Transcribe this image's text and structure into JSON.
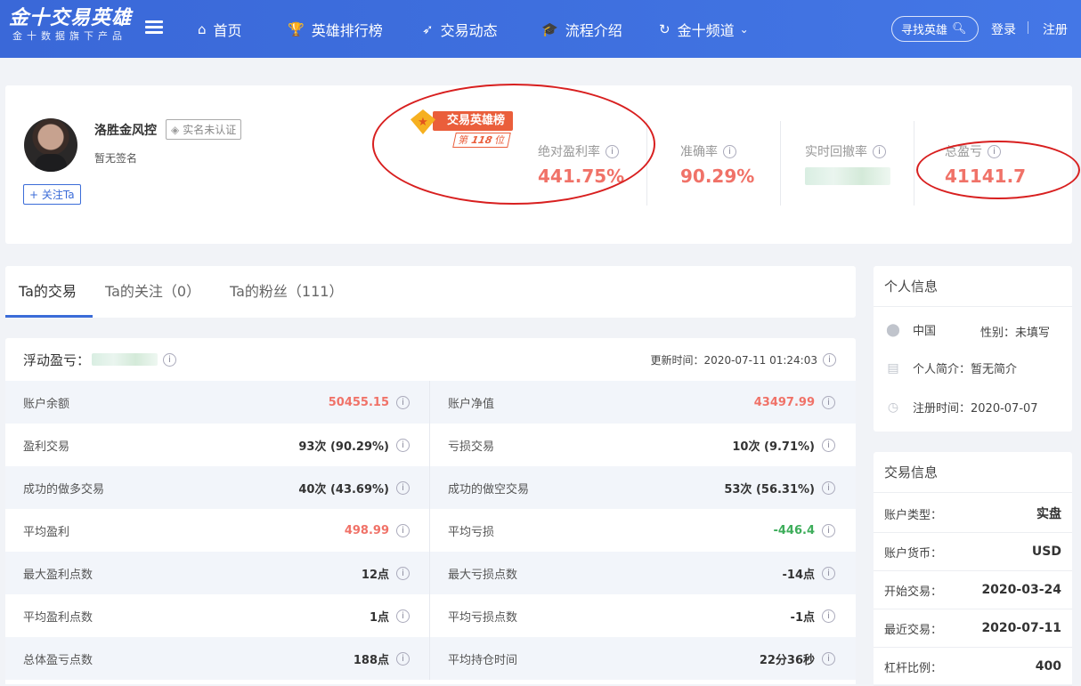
{
  "nav": {
    "logo_title": "金十交易英雄",
    "logo_subtitle": "金十数据旗下产品",
    "items": [
      {
        "label": "首页",
        "icon": "home-icon",
        "glyph": "⌂"
      },
      {
        "label": "英雄排行榜",
        "icon": "trophy-icon",
        "glyph": "🏆"
      },
      {
        "label": "交易动态",
        "icon": "rocket-icon",
        "glyph": "➶"
      },
      {
        "label": "流程介绍",
        "icon": "graduation-cap-icon",
        "glyph": "🎓"
      },
      {
        "label": "金十频道",
        "icon": "refresh-icon",
        "glyph": "↻"
      }
    ],
    "search_label": "寻找英雄",
    "login": "登录",
    "register": "注册"
  },
  "profile": {
    "name": "洛胜金风控",
    "verify_label": "实名未认证",
    "signature": "暂无签名",
    "follow_label": "+ 关注Ta",
    "hero_badge": {
      "title": "交易英雄榜",
      "rank_prefix": "第",
      "rank": "118",
      "rank_suffix": "位"
    },
    "stats": [
      {
        "label": "绝对盈利率",
        "value": "441.75%"
      },
      {
        "label": "准确率",
        "value": "90.29%"
      },
      {
        "label": "实时回撤率",
        "value": ""
      },
      {
        "label": "总盈亏",
        "value": "41141.7"
      }
    ]
  },
  "tabs": [
    {
      "label": "Ta的交易"
    },
    {
      "label": "Ta的关注（0）"
    },
    {
      "label": "Ta的粉丝（111）"
    }
  ],
  "trade": {
    "float_label": "浮动盈亏：",
    "update_time": "更新时间：2020-07-11 01:24:03",
    "rows": [
      [
        {
          "label": "账户余额",
          "value": "50455.15",
          "color": "red"
        },
        {
          "label": "账户净值",
          "value": "43497.99",
          "color": "red"
        }
      ],
      [
        {
          "label": "盈利交易",
          "value": "93次 (90.29%)",
          "color": ""
        },
        {
          "label": "亏损交易",
          "value": "10次 (9.71%)",
          "color": ""
        }
      ],
      [
        {
          "label": "成功的做多交易",
          "value": "40次 (43.69%)",
          "color": ""
        },
        {
          "label": "成功的做空交易",
          "value": "53次 (56.31%)",
          "color": ""
        }
      ],
      [
        {
          "label": "平均盈利",
          "value": "498.99",
          "color": "red"
        },
        {
          "label": "平均亏损",
          "value": "-446.4",
          "color": "green"
        }
      ],
      [
        {
          "label": "最大盈利点数",
          "value": "12点",
          "color": ""
        },
        {
          "label": "最大亏损点数",
          "value": "-14点",
          "color": ""
        }
      ],
      [
        {
          "label": "平均盈利点数",
          "value": "1点",
          "color": ""
        },
        {
          "label": "平均亏损点数",
          "value": "-1点",
          "color": ""
        }
      ],
      [
        {
          "label": "总体盈亏点数",
          "value": "188点",
          "color": ""
        },
        {
          "label": "平均持仓时间",
          "value": "22分36秒",
          "color": ""
        }
      ]
    ]
  },
  "personal": {
    "title": "个人信息",
    "location": "中国",
    "gender": "性别：未填写",
    "bio": "个人简介：暂无简介",
    "register_time": "注册时间：2020-07-07"
  },
  "account": {
    "title": "交易信息",
    "items": [
      {
        "key": "账户类型：",
        "value": "实盘"
      },
      {
        "key": "账户货币：",
        "value": "USD"
      },
      {
        "key": "开始交易：",
        "value": "2020-03-24"
      },
      {
        "key": "最近交易：",
        "value": "2020-07-11"
      },
      {
        "key": "杠杆比例：",
        "value": "400"
      }
    ]
  },
  "colors": {
    "nav_bg": "#3e6fde",
    "accent_blue": "#3b6cd8",
    "profit_red": "#f07268",
    "loss_green": "#3dad5a",
    "annotation_red": "#d81f1f"
  }
}
